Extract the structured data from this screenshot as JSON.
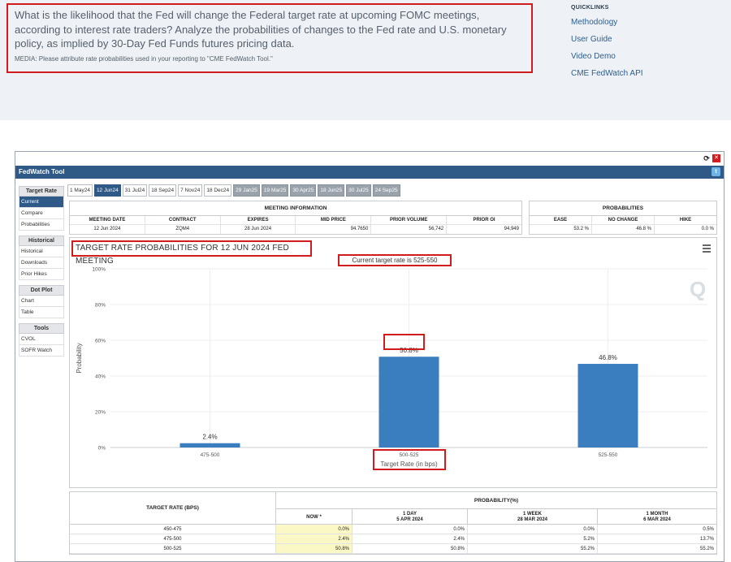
{
  "intro": {
    "question": "What is the likelihood that the Fed will change the Federal target rate at upcoming FOMC meetings, according to interest rate traders? Analyze the probabilities of changes to the Fed rate and U.S. monetary policy, as implied by 30-Day Fed Funds futures pricing data.",
    "media_note": "MEDIA: Please attribute rate probabilities used in your reporting to \"CME FedWatch Tool.\""
  },
  "quicklinks": {
    "title": "QUICKLINKS",
    "links": [
      "Methodology",
      "User Guide",
      "Video Demo",
      "CME FedWatch API"
    ]
  },
  "tool": {
    "header": "FedWatch Tool",
    "sidebar": [
      {
        "title": "Target Rate",
        "items": [
          "Current",
          "Compare",
          "Probabilities"
        ]
      },
      {
        "title": "Historical",
        "items": [
          "Historical",
          "Downloads",
          "Prior Hikes"
        ]
      },
      {
        "title": "Dot Plot",
        "items": [
          "Chart",
          "Table"
        ]
      },
      {
        "title": "Tools",
        "items": [
          "CVOL",
          "SOFR Watch"
        ]
      }
    ],
    "tabs": [
      "1 May24",
      "12 Jun24",
      "31 Jul24",
      "18 Sep24",
      "7 Nov24",
      "18 Dec24",
      "29 Jan25",
      "19 Mar25",
      "30 Apr25",
      "18 Jun25",
      "30 Jul25",
      "24 Sep25"
    ],
    "active_tab": 1
  },
  "meeting_info": {
    "title": "MEETING INFORMATION",
    "headers": [
      "MEETING DATE",
      "CONTRACT",
      "EXPIRES",
      "MID PRICE",
      "PRIOR VOLUME",
      "PRIOR OI"
    ],
    "values": [
      "12 Jun 2024",
      "ZQM4",
      "28 Jun 2024",
      "94.7650",
      "56,742",
      "94,949"
    ]
  },
  "probabilities": {
    "title": "PROBABILITIES",
    "headers": [
      "EASE",
      "NO CHANGE",
      "HIKE"
    ],
    "values": [
      "53.2 %",
      "46.8 %",
      "0.0 %"
    ]
  },
  "chart": {
    "title_text": "TARGET RATE PROBABILITIES FOR 12 JUN 2024 FED MEETING",
    "current_rate": "Current target rate is 525-550",
    "logo_letter": "Q"
  },
  "chart_data": {
    "type": "bar",
    "categories": [
      "475-500",
      "500-525",
      "525-550"
    ],
    "values": [
      2.4,
      50.8,
      46.8
    ],
    "value_labels": [
      "2.4%",
      "50.8%",
      "46.8%"
    ],
    "xlabel": "Target Rate (in bps)",
    "ylabel": "Probability",
    "ylim": [
      0,
      100
    ],
    "yticks": [
      "0%",
      "20%",
      "40%",
      "60%",
      "80%",
      "100%"
    ],
    "grid": true,
    "bar_color": "#3a7ebf"
  },
  "bottom_table": {
    "rate_header": "TARGET RATE (BPS)",
    "prob_title": "PROBABILITY(%)",
    "cols": [
      {
        "l1": "NOW *",
        "l2": ""
      },
      {
        "l1": "1 DAY",
        "l2": "5 APR 2024"
      },
      {
        "l1": "1 WEEK",
        "l2": "28 MAR 2024"
      },
      {
        "l1": "1 MONTH",
        "l2": "6 MAR 2024"
      }
    ],
    "rows": [
      {
        "rate": "450-475",
        "vals": [
          "0.0%",
          "0.0%",
          "0.0%",
          "0.5%"
        ]
      },
      {
        "rate": "475-500",
        "vals": [
          "2.4%",
          "2.4%",
          "5.2%",
          "13.7%"
        ]
      },
      {
        "rate": "500-525",
        "vals": [
          "50.8%",
          "50.8%",
          "55.2%",
          "55.2%"
        ]
      }
    ]
  }
}
